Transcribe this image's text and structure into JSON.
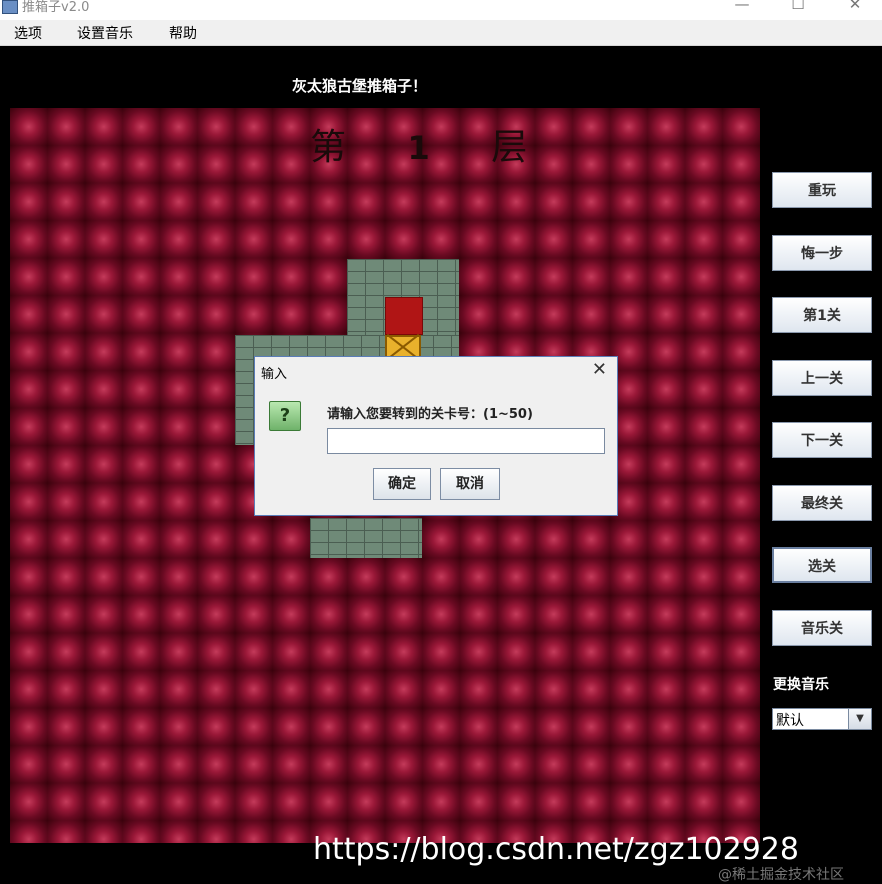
{
  "window": {
    "title": "推箱子v2.0",
    "controls": {
      "minimize": "—",
      "maximize": "☐",
      "close": "✕"
    }
  },
  "menu": [
    "选项",
    "设置音乐",
    "帮助"
  ],
  "game": {
    "caption": "灰太狼古堡推箱子！",
    "level_title": {
      "prefix": "第",
      "number": "1",
      "suffix": "层"
    }
  },
  "side_buttons": [
    "重玩",
    "悔一步",
    "第1关",
    "上一关",
    "下一关",
    "最终关",
    "选关",
    "音乐关"
  ],
  "music": {
    "label": "更换音乐",
    "selected": "默认",
    "arrow": "▼"
  },
  "dialog": {
    "title": "输入",
    "close": "✕",
    "icon_glyph": "?",
    "message": "请输入您要转到的关卡号：(1~50)",
    "input_value": "",
    "ok_label": "确定",
    "cancel_label": "取消"
  },
  "watermark": {
    "url": "https://blog.csdn.net/zgz102928",
    "site": "@稀土掘金技术社区"
  },
  "colors": {
    "board": "#5c0718",
    "wall": "#6f8a78",
    "goal": "#b01515",
    "crate": "#e9b12c",
    "dialog_border": "#5a7cb8"
  }
}
